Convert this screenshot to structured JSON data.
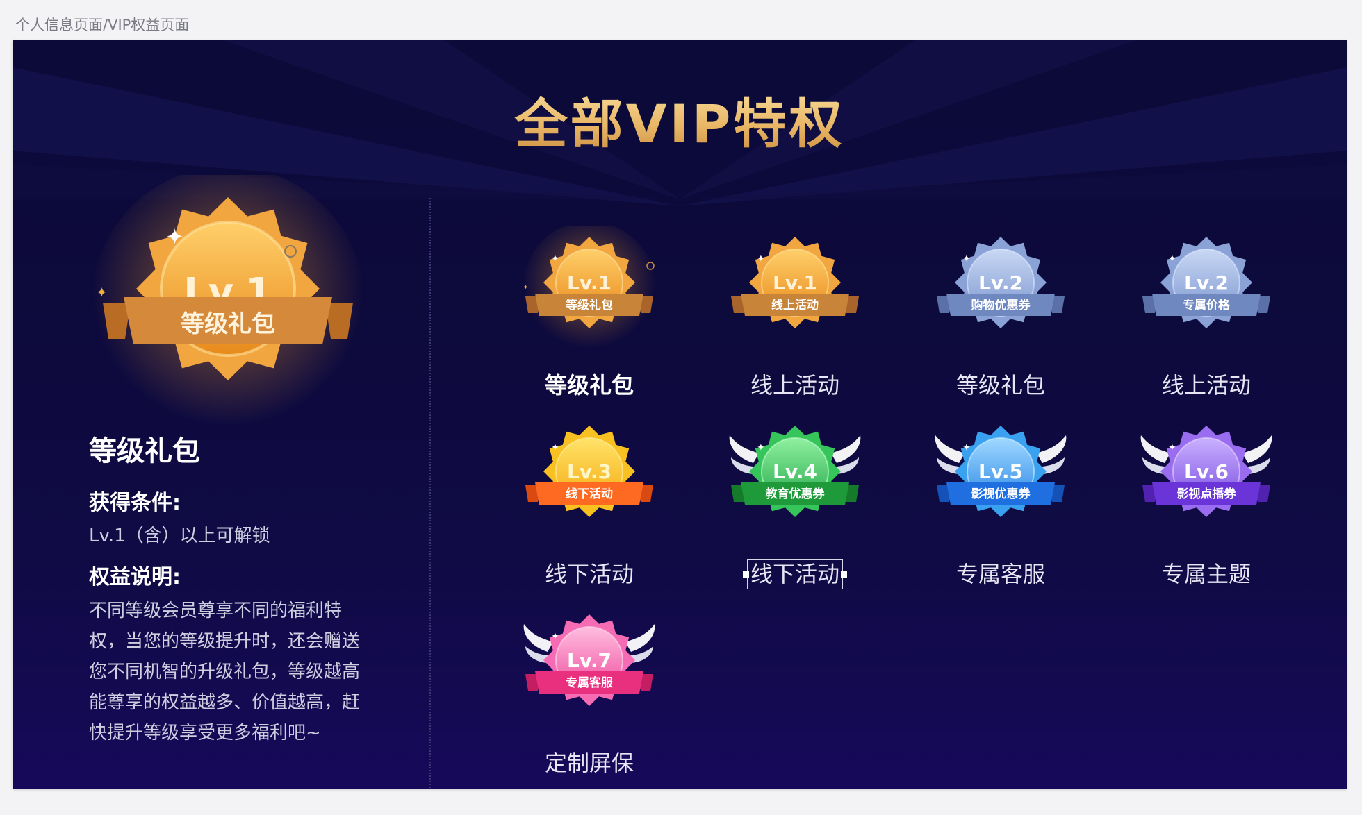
{
  "breadcrumb": "个人信息页面/VIP权益页面",
  "title": "全部VIP特权",
  "featured": {
    "badge_level": "Lv.1",
    "badge_label": "等级礼包",
    "title": "等级礼包",
    "condition_heading": "获得条件:",
    "condition_text": "Lv.1（含）以上可解锁",
    "desc_heading": "权益说明:",
    "desc_lines": [
      "不同等级会员尊享不同的福利特",
      "权，当您的等级提升时，还会赠送",
      "您不同机智的升级礼包，等级越高",
      "能尊享的权益越多、价值越高，赶",
      "快提升等级享受更多福利吧~"
    ]
  },
  "privileges": [
    {
      "level": "Lv.1",
      "ribbon": "等级礼包",
      "label": "等级礼包",
      "theme": "gold",
      "wings": false,
      "active": true
    },
    {
      "level": "Lv.1",
      "ribbon": "线上活动",
      "label": "线上活动",
      "theme": "gold",
      "wings": false
    },
    {
      "level": "Lv.2",
      "ribbon": "购物优惠券",
      "label": "等级礼包",
      "theme": "silver",
      "wings": false
    },
    {
      "level": "Lv.2",
      "ribbon": "专属价格",
      "label": "线上活动",
      "theme": "silver",
      "wings": false
    },
    {
      "level": "Lv.3",
      "ribbon": "线下活动",
      "label": "线下活动",
      "theme": "yellow",
      "wings": false
    },
    {
      "level": "Lv.4",
      "ribbon": "教育优惠券",
      "label": "线下活动",
      "theme": "green",
      "wings": true,
      "selected": true
    },
    {
      "level": "Lv.5",
      "ribbon": "影视优惠券",
      "label": "专属客服",
      "theme": "blue",
      "wings": true
    },
    {
      "level": "Lv.6",
      "ribbon": "影视点播券",
      "label": "专属主题",
      "theme": "purple",
      "wings": true
    },
    {
      "level": "Lv.7",
      "ribbon": "专属客服",
      "label": "定制屏保",
      "theme": "pink",
      "wings": true
    }
  ],
  "colors": {
    "background": "#0d0a3c",
    "title_gold": "#e8b564",
    "gold": "#f2a93c",
    "silver": "#8fa6d8",
    "yellow": "#f8c020",
    "green": "#3bc35a",
    "blue": "#3aa0f0",
    "purple": "#9a6cf0",
    "pink": "#f66cb4"
  }
}
